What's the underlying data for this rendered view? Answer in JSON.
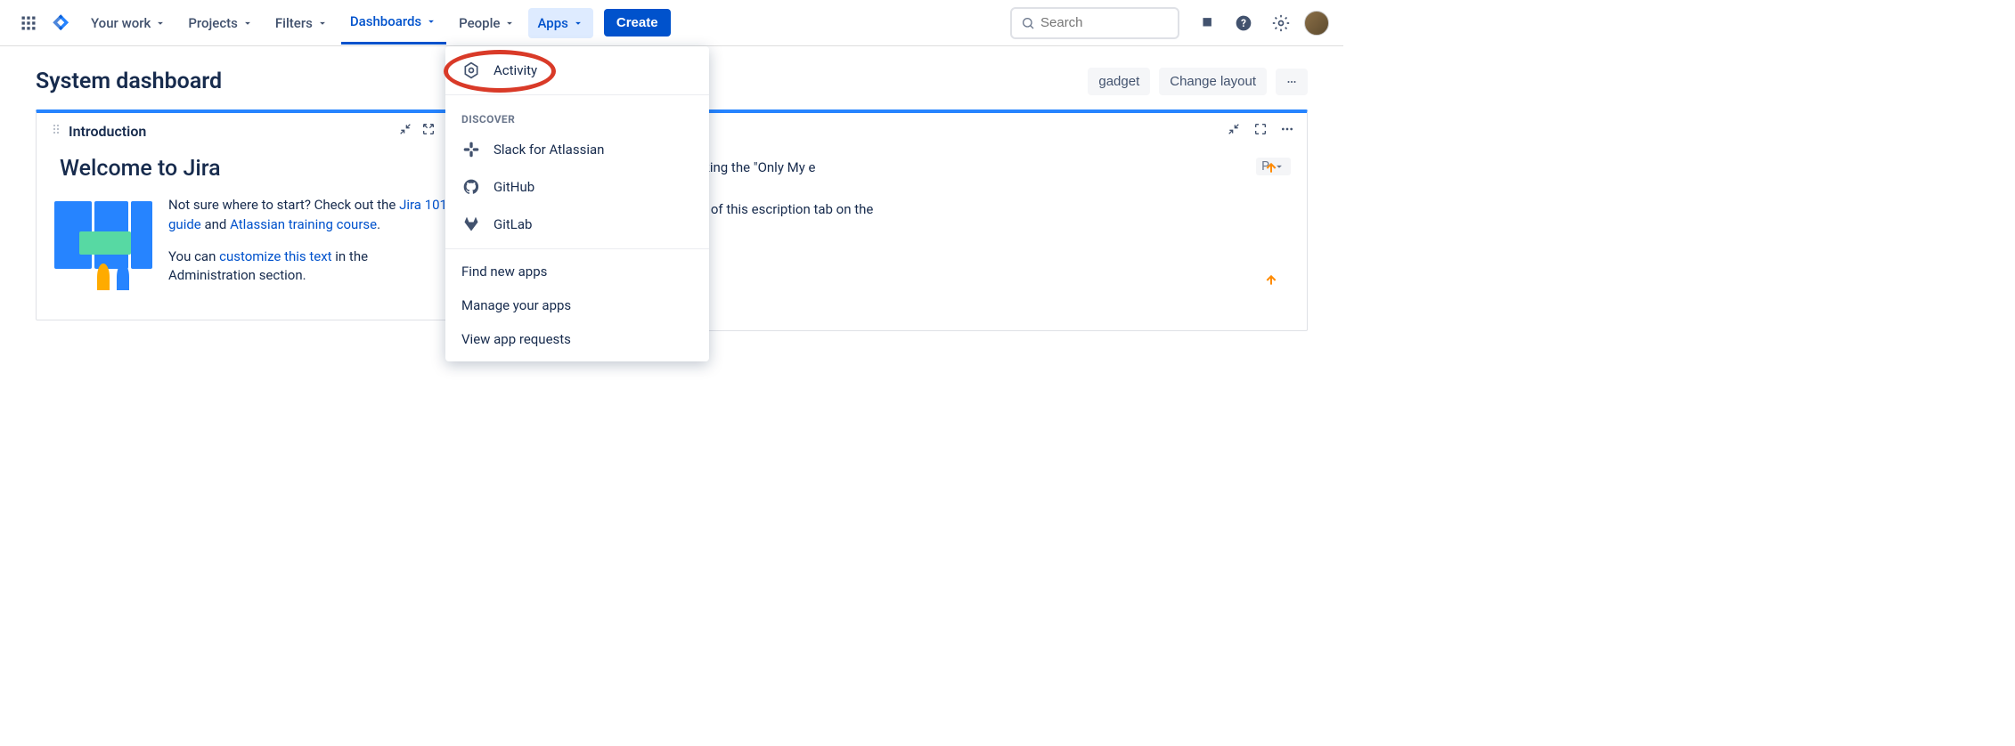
{
  "nav": {
    "your_work": "Your work",
    "projects": "Projects",
    "filters": "Filters",
    "dashboards": "Dashboards",
    "people": "People",
    "apps": "Apps",
    "create": "Create",
    "search_placeholder": "Search"
  },
  "page": {
    "title": "System dashboard",
    "add_gadget_partial": "gadget",
    "change_layout": "Change layout"
  },
  "intro_widget": {
    "title": "Introduction",
    "welcome": "Welcome to Jira",
    "p1_a": "Not sure where to start? Check out the ",
    "link1": "Jira 101 guide",
    "p1_b": " and ",
    "link2": "Atlassian training course",
    "p1_c": ".",
    "p2_a": "You can ",
    "link3": "customize this text",
    "p2_b": " in the Administration section."
  },
  "right_widget": {
    "col_p": "P",
    "line1": "rtant items on the misable \"Quick :king the \"Only My e",
    "line2": "to learn about Scrum link at the left of this escription tab on the"
  },
  "apps_menu": {
    "activity": "Activity",
    "discover_heading": "DISCOVER",
    "slack": "Slack for Atlassian",
    "github": "GitHub",
    "gitlab": "GitLab",
    "find": "Find new apps",
    "manage": "Manage your apps",
    "view": "View app requests"
  }
}
